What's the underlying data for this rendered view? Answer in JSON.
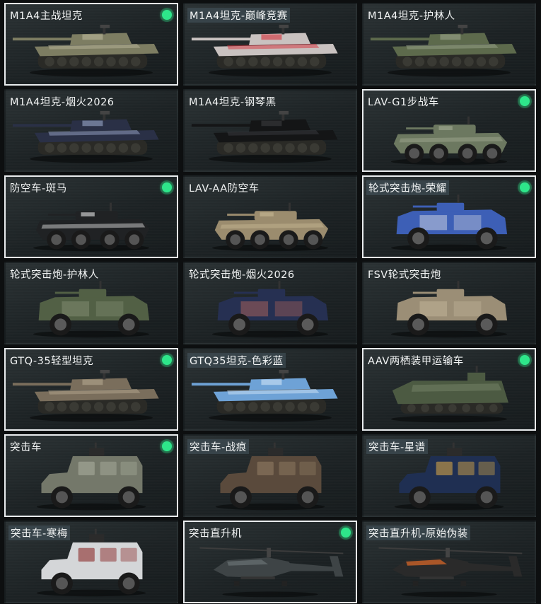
{
  "vehicles": [
    {
      "name": "M1A4主战坦克",
      "kind": "tank",
      "owned": true,
      "body": "#7d7d62",
      "accent": "#b9b59a",
      "highlight": false
    },
    {
      "name": "M1A4坦克-巅峰竞赛",
      "kind": "tank",
      "owned": false,
      "body": "#c9c2c0",
      "accent": "#d6303a",
      "highlight": true
    },
    {
      "name": "M1A4坦克-护林人",
      "kind": "tank",
      "owned": false,
      "body": "#5d6a4c",
      "accent": "#9aa38a",
      "highlight": false
    },
    {
      "name": "M1A4坦克-烟火2026",
      "kind": "tank",
      "owned": false,
      "body": "#2a3046",
      "accent": "#9aa6c8",
      "highlight": false
    },
    {
      "name": "M1A4坦克-钢琴黑",
      "kind": "tank",
      "owned": false,
      "body": "#141516",
      "accent": "#3a3c40",
      "highlight": false
    },
    {
      "name": "LAV-G1步战车",
      "kind": "wheeled8",
      "owned": true,
      "body": "#6c7860",
      "accent": "#a3ab95",
      "highlight": false
    },
    {
      "name": "防空车-斑马",
      "kind": "wheeled8",
      "owned": true,
      "body": "#202224",
      "accent": "#e6e6e6",
      "highlight": false
    },
    {
      "name": "LAV-AA防空车",
      "kind": "wheeled8",
      "owned": false,
      "body": "#9b8c6e",
      "accent": "#c8b995",
      "highlight": false
    },
    {
      "name": "轮式突击炮-荣耀",
      "kind": "wheeled4",
      "owned": true,
      "body": "#3d5fb6",
      "accent": "#e4e4e6",
      "highlight": true
    },
    {
      "name": "轮式突击炮-护林人",
      "kind": "wheeled4",
      "owned": false,
      "body": "#526045",
      "accent": "#8a9478",
      "highlight": false
    },
    {
      "name": "轮式突击炮-烟火2026",
      "kind": "wheeled4",
      "owned": false,
      "body": "#263052",
      "accent": "#c26a5a",
      "highlight": false
    },
    {
      "name": "FSV轮式突击炮",
      "kind": "wheeled4",
      "owned": false,
      "body": "#9b8e76",
      "accent": "#c7bba0",
      "highlight": false
    },
    {
      "name": "GTQ-35轻型坦克",
      "kind": "tank",
      "owned": true,
      "body": "#7a6e5c",
      "accent": "#b3a68e",
      "highlight": false
    },
    {
      "name": "GTQ35坦克-色彩蓝",
      "kind": "tank",
      "owned": false,
      "body": "#6ea2d6",
      "accent": "#cfe3f5",
      "highlight": true
    },
    {
      "name": "AAV两栖装甲运输车",
      "kind": "amphib",
      "owned": true,
      "body": "#4c5a42",
      "accent": "#7c8a6c",
      "highlight": false
    },
    {
      "name": "突击车",
      "kind": "mrap",
      "owned": true,
      "body": "#74786a",
      "accent": "#a8ac9c",
      "highlight": false
    },
    {
      "name": "突击车-战痕",
      "kind": "mrap",
      "owned": false,
      "body": "#5a4a3c",
      "accent": "#8f7c62",
      "highlight": true
    },
    {
      "name": "突击车-星谱",
      "kind": "mrap",
      "owned": false,
      "body": "#1f2f52",
      "accent": "#d2a447",
      "highlight": true
    },
    {
      "name": "突击车-寒梅",
      "kind": "mrap",
      "owned": false,
      "body": "#d4d6d8",
      "accent": "#8a2a2a",
      "highlight": true
    },
    {
      "name": "突击直升机",
      "kind": "heli",
      "owned": true,
      "body": "#3e4446",
      "accent": "#6a7274",
      "highlight": false
    },
    {
      "name": "突击直升机-原始伪装",
      "kind": "heli",
      "owned": false,
      "body": "#2a2a2a",
      "accent": "#e06a28",
      "highlight": true
    }
  ]
}
